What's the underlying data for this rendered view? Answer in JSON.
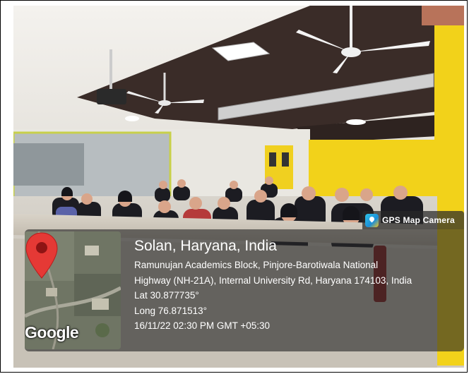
{
  "app": {
    "name": "GPS Map Camera",
    "icon": "gps-map-camera-logo-icon"
  },
  "location": {
    "title": "Solan, Haryana, India",
    "address_line_1": "Ramunujan Academics Block, Pinjore-Barotiwala National",
    "address_line_2": "Highway (NH-21A), Internal University Rd, Haryana 174103, India",
    "latitude": "Lat 30.877735°",
    "longitude": "Long 76.871513°",
    "timestamp": "16/11/22 02:30 PM GMT +05:30"
  },
  "map": {
    "provider": "Google",
    "marker_icon": "map-pin-icon",
    "marker_color": "#e53935"
  },
  "colors": {
    "overlay": "#262626",
    "wall_yellow": "#f2d21a",
    "ceiling_dark": "#3a2c28"
  }
}
